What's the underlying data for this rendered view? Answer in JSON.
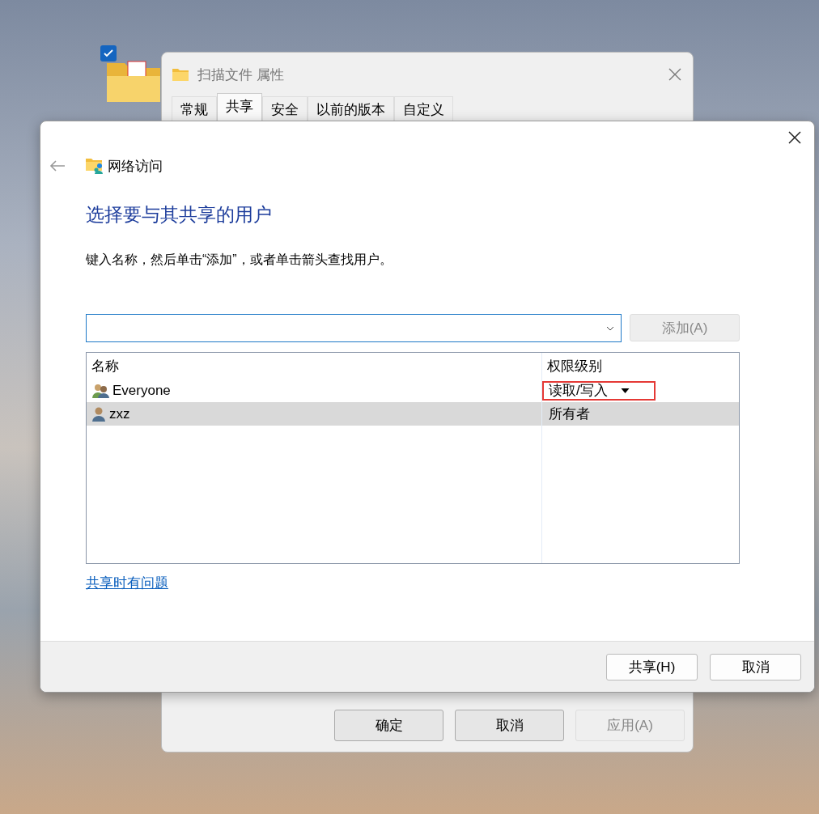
{
  "desktop_icon": {
    "checked": true
  },
  "properties_window": {
    "title": "扫描文件 属性",
    "tabs": [
      {
        "label": "常规",
        "selected": false
      },
      {
        "label": "共享",
        "selected": true
      },
      {
        "label": "安全",
        "selected": false
      },
      {
        "label": "以前的版本",
        "selected": false
      },
      {
        "label": "自定义",
        "selected": false
      }
    ],
    "buttons": [
      {
        "label": "确定",
        "disabled": false
      },
      {
        "label": "取消",
        "disabled": false
      },
      {
        "label": "应用(A)",
        "disabled": true
      }
    ]
  },
  "dialog": {
    "nav_title": "网络访问",
    "heading": "选择要与其共享的用户",
    "instruction": "键入名称，然后单击“添加”，或者单击箭头查找用户。",
    "add_button": {
      "label": "添加(A)",
      "disabled": true
    },
    "columns": [
      "名称",
      "权限级别"
    ],
    "rows": [
      {
        "kind": "group",
        "name": "Everyone",
        "permission": "读取/写入",
        "dropdown": true,
        "highlighted": true,
        "selected": false
      },
      {
        "kind": "user",
        "name": "zxz",
        "permission": "所有者",
        "dropdown": false,
        "highlighted": false,
        "selected": true
      }
    ],
    "help_link": "共享时有问题",
    "buttons": [
      {
        "label": "共享(H)",
        "disabled": false
      },
      {
        "label": "取消",
        "disabled": false
      }
    ]
  }
}
